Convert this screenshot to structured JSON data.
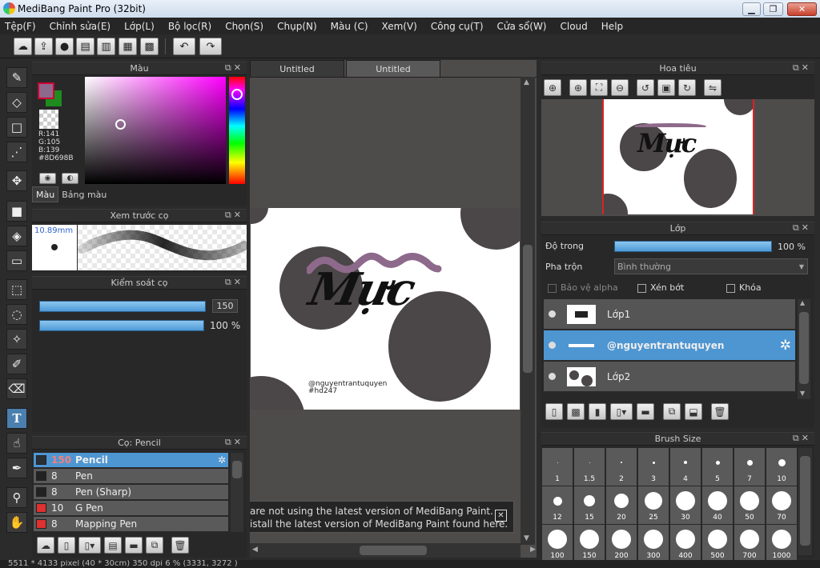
{
  "window": {
    "title": "MediBang Paint Pro (32bit)",
    "minimize": "▁",
    "maximize": "❐",
    "close": "✕"
  },
  "menu": [
    "Tệp(F)",
    "Chỉnh sửa(E)",
    "Lớp(L)",
    "Bộ lọc(R)",
    "Chọn(S)",
    "Chụp(N)",
    "Màu (C)",
    "Xem(V)",
    "Công cụ(T)",
    "Cửa sổ(W)",
    "Cloud",
    "Help"
  ],
  "toolbar_icons": [
    "cloud-icon",
    "share-icon",
    "comment-icon",
    "message-icon",
    "document-icon",
    "table-icon",
    "grid-edit-icon",
    "undo-icon",
    "redo-icon"
  ],
  "tools": [
    "brush-icon",
    "eraser-icon",
    "rectangle-icon",
    "dot-brush-icon",
    "move-icon",
    "fill-rect-icon",
    "bucket-icon",
    "gradient-icon",
    "select-rect-icon",
    "lasso-icon",
    "magic-wand-icon",
    "select-pen-icon",
    "select-eraser-icon",
    "text-icon",
    "hand-pointer-icon",
    "pen-icon",
    "eyedropper-icon",
    "hand-icon"
  ],
  "color_panel": {
    "title": "Màu",
    "main_color": "#8D698B",
    "sub_color": "#1E8C1E",
    "r": "R:141",
    "g": "G:105",
    "b": "B:139",
    "hex": "#8D698B",
    "tabs": [
      "Màu",
      "Bảng màu"
    ]
  },
  "preview_panel": {
    "title": "Xem trước cọ",
    "size": "10.89mm"
  },
  "brush_control": {
    "title": "Kiểm soát cọ",
    "size_value": "150",
    "opacity_value": "100 %"
  },
  "brush_panel": {
    "title": "Cọ: Pencil",
    "items": [
      {
        "size": "150",
        "name": "Pencil",
        "color": "#2a3038",
        "selected": true
      },
      {
        "size": "8",
        "name": "Pen",
        "color": "#222222",
        "selected": false
      },
      {
        "size": "8",
        "name": "Pen (Sharp)",
        "color": "#222222",
        "selected": false
      },
      {
        "size": "10",
        "name": "G Pen",
        "color": "#e03030",
        "selected": false
      },
      {
        "size": "8",
        "name": "Mapping Pen",
        "color": "#e03030",
        "selected": false
      }
    ]
  },
  "canvas": {
    "tabs": [
      "Untitled",
      "Untitled"
    ],
    "artwork": {
      "title_text": "Mực",
      "handle": "@nguyentrantuquyen",
      "tag": "#hd247"
    },
    "notification": {
      "line1": "are not using the latest version of MediBang Paint.",
      "line2": "istall the latest version of MediBang Paint found here.",
      "close": "✕"
    }
  },
  "navigator": {
    "title": "Hoa tiêu",
    "buttons": [
      "zoom-fit-icon",
      "zoom-in-icon",
      "fit-window-icon",
      "zoom-out-icon",
      "rotate-left-icon",
      "actual-size-icon",
      "rotate-right-icon",
      "flip-icon"
    ]
  },
  "layers": {
    "title": "Lớp",
    "opacity_label": "Độ trong",
    "opacity_value": "100 %",
    "blend_label": "Pha trộn",
    "blend_value": "Bình thường",
    "protect_alpha": "Bảo vệ alpha",
    "clipping": "Xén bớt",
    "lock": "Khóa",
    "items": [
      {
        "name": "Lớp1",
        "selected": false
      },
      {
        "name": "@nguyentrantuquyen",
        "selected": true
      },
      {
        "name": "Lớp2",
        "selected": false
      }
    ]
  },
  "brush_size": {
    "title": "Brush Size",
    "sizes": [
      "1",
      "1.5",
      "2",
      "3",
      "4",
      "5",
      "7",
      "10",
      "12",
      "15",
      "20",
      "25",
      "30",
      "40",
      "50",
      "70",
      "100",
      "150",
      "200",
      "300",
      "400",
      "500",
      "700",
      "1000"
    ]
  },
  "status": "5511 * 4133 pixel   (40 * 30cm)   350 dpi   6 %   (3331, 3272 )"
}
